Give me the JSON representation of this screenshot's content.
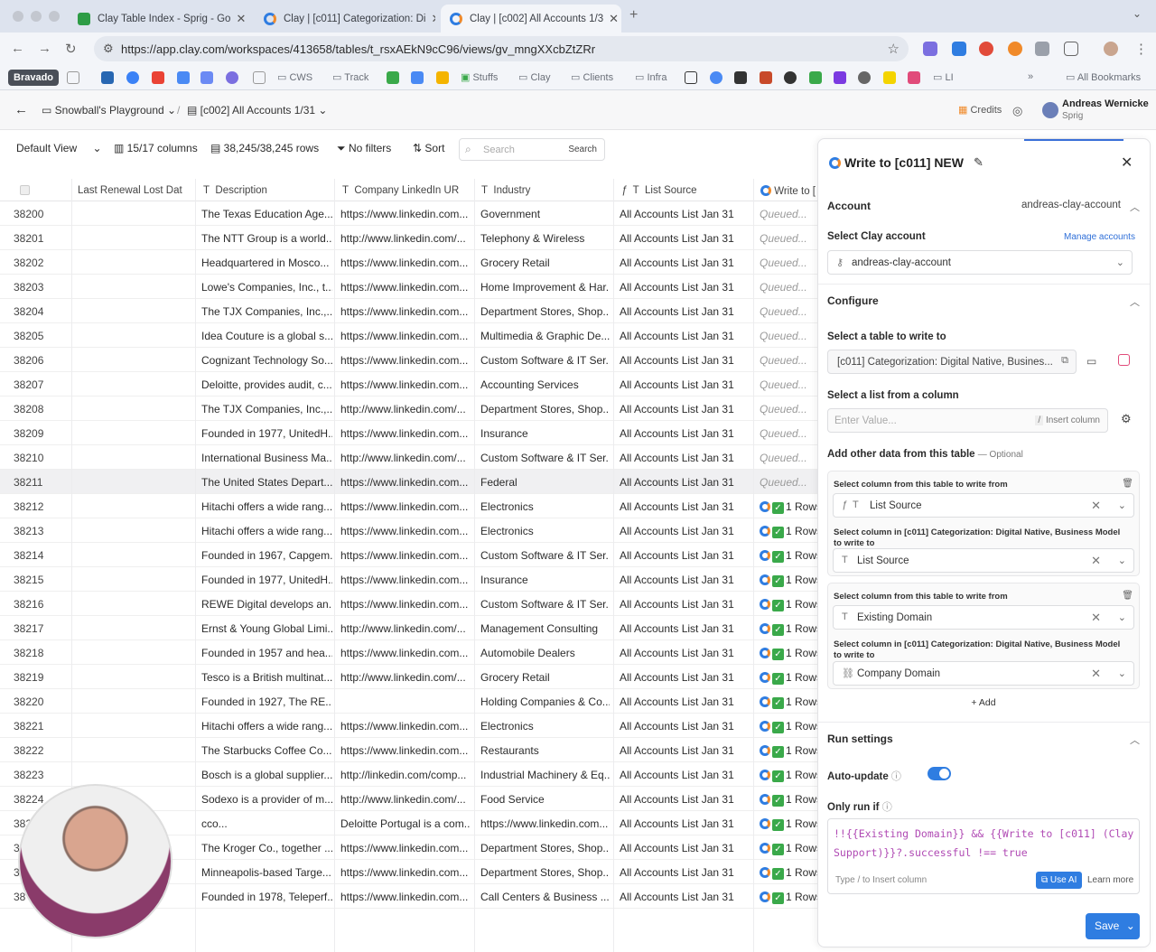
{
  "browser": {
    "tabs": [
      {
        "title": "Clay Table Index - Sprig - Go",
        "active": false
      },
      {
        "title": "Clay | [c011] Categorization: Di",
        "active": false
      },
      {
        "title": "Clay | [c002] All Accounts 1/3",
        "active": true
      }
    ],
    "url": "https://app.clay.com/workspaces/413658/tables/t_rsxAEkN9cC96/views/gv_mngXXcbZtZRr",
    "bookmarks": [
      "Bravado",
      "CWS",
      "Track",
      "Stuffs",
      "Clay",
      "Clients",
      "Infra",
      "LI",
      "All Bookmarks"
    ]
  },
  "header": {
    "workspace": "Snowball's Playground",
    "table": "[c002] All Accounts 1/31",
    "credits": "Credits",
    "user_name": "Andreas Wernicke",
    "user_org": "Sprig"
  },
  "toolbar": {
    "view": "Default View",
    "columns": "15/17 columns",
    "rows": "38,245/38,245 rows",
    "filters": "No filters",
    "sort": "Sort",
    "search_placeholder": "Search",
    "search_btn": "Search"
  },
  "grid": {
    "headers": [
      "Last Renewal Lost Dat",
      "Description",
      "Company LinkedIn UR",
      "Industry",
      "List Source",
      "Write to ["
    ],
    "rows": [
      {
        "num": "38200",
        "desc": "The Texas Education Age...",
        "li": "https://www.linkedin.com...",
        "ind": "Government",
        "ls": "All Accounts List Jan 31",
        "wr": "Queued..."
      },
      {
        "num": "38201",
        "desc": "The NTT Group is a world...",
        "li": "http://www.linkedin.com/...",
        "ind": "Telephony & Wireless",
        "ls": "All Accounts List Jan 31",
        "wr": "Queued..."
      },
      {
        "num": "38202",
        "desc": "Headquartered in Mosco...",
        "li": "https://www.linkedin.com...",
        "ind": "Grocery Retail",
        "ls": "All Accounts List Jan 31",
        "wr": "Queued..."
      },
      {
        "num": "38203",
        "desc": "Lowe's Companies, Inc., t...",
        "li": "https://www.linkedin.com...",
        "ind": "Home Improvement & Har...",
        "ls": "All Accounts List Jan 31",
        "wr": "Queued..."
      },
      {
        "num": "38204",
        "desc": "The TJX Companies, Inc.,...",
        "li": "https://www.linkedin.com...",
        "ind": "Department Stores, Shop...",
        "ls": "All Accounts List Jan 31",
        "wr": "Queued..."
      },
      {
        "num": "38205",
        "desc": "Idea Couture is a global s...",
        "li": "https://www.linkedin.com...",
        "ind": "Multimedia & Graphic De...",
        "ls": "All Accounts List Jan 31",
        "wr": "Queued..."
      },
      {
        "num": "38206",
        "desc": "Cognizant Technology So...",
        "li": "https://www.linkedin.com...",
        "ind": "Custom Software & IT Ser...",
        "ls": "All Accounts List Jan 31",
        "wr": "Queued..."
      },
      {
        "num": "38207",
        "desc": "Deloitte, provides audit, c...",
        "li": "https://www.linkedin.com...",
        "ind": "Accounting Services",
        "ls": "All Accounts List Jan 31",
        "wr": "Queued..."
      },
      {
        "num": "38208",
        "desc": "The TJX Companies, Inc.,...",
        "li": "http://www.linkedin.com/...",
        "ind": "Department Stores, Shop...",
        "ls": "All Accounts List Jan 31",
        "wr": "Queued..."
      },
      {
        "num": "38209",
        "desc": "Founded in 1977, UnitedH...",
        "li": "https://www.linkedin.com...",
        "ind": "Insurance",
        "ls": "All Accounts List Jan 31",
        "wr": "Queued..."
      },
      {
        "num": "38210",
        "desc": "International Business Ma...",
        "li": "http://www.linkedin.com/...",
        "ind": "Custom Software & IT Ser...",
        "ls": "All Accounts List Jan 31",
        "wr": "Queued..."
      },
      {
        "num": "38211",
        "desc": "The United States Depart...",
        "li": "https://www.linkedin.com...",
        "ind": "Federal",
        "ls": "All Accounts List Jan 31",
        "wr": "Queued...",
        "hl": true
      },
      {
        "num": "38212",
        "desc": "Hitachi offers a wide rang...",
        "li": "https://www.linkedin.com...",
        "ind": "Electronics",
        "ls": "All Accounts List Jan 31",
        "wr": "1 Rows"
      },
      {
        "num": "38213",
        "desc": "Hitachi offers a wide rang...",
        "li": "https://www.linkedin.com...",
        "ind": "Electronics",
        "ls": "All Accounts List Jan 31",
        "wr": "1 Rows"
      },
      {
        "num": "38214",
        "desc": "Founded in 1967, Capgem...",
        "li": "https://www.linkedin.com...",
        "ind": "Custom Software & IT Ser...",
        "ls": "All Accounts List Jan 31",
        "wr": "1 Rows"
      },
      {
        "num": "38215",
        "desc": "Founded in 1977, UnitedH...",
        "li": "https://www.linkedin.com...",
        "ind": "Insurance",
        "ls": "All Accounts List Jan 31",
        "wr": "1 Rows"
      },
      {
        "num": "38216",
        "desc": "REWE Digital develops an...",
        "li": "https://www.linkedin.com...",
        "ind": "Custom Software & IT Ser...",
        "ls": "All Accounts List Jan 31",
        "wr": "1 Rows"
      },
      {
        "num": "38217",
        "desc": "Ernst & Young Global Limi...",
        "li": "http://www.linkedin.com/...",
        "ind": "Management Consulting",
        "ls": "All Accounts List Jan 31",
        "wr": "1 Rows"
      },
      {
        "num": "38218",
        "desc": "Founded in 1957 and hea...",
        "li": "https://www.linkedin.com...",
        "ind": "Automobile Dealers",
        "ls": "All Accounts List Jan 31",
        "wr": "1 Rows"
      },
      {
        "num": "38219",
        "desc": "Tesco is a British multinat...",
        "li": "http://www.linkedin.com/...",
        "ind": "Grocery Retail",
        "ls": "All Accounts List Jan 31",
        "wr": "1 Rows"
      },
      {
        "num": "38220",
        "desc": "Founded in 1927, The RE...",
        "li": "",
        "ind": "Holding Companies & Co...",
        "ls": "All Accounts List Jan 31",
        "wr": "1 Rows"
      },
      {
        "num": "38221",
        "desc": "Hitachi offers a wide rang...",
        "li": "https://www.linkedin.com...",
        "ind": "Electronics",
        "ls": "All Accounts List Jan 31",
        "wr": "1 Rows"
      },
      {
        "num": "38222",
        "desc": "The Starbucks Coffee Co...",
        "li": "https://www.linkedin.com...",
        "ind": "Restaurants",
        "ls": "All Accounts List Jan 31",
        "wr": "1 Rows"
      },
      {
        "num": "38223",
        "desc": "Bosch is a global supplier...",
        "li": "http://linkedin.com/comp...",
        "ind": "Industrial Machinery & Eq...",
        "ls": "All Accounts List Jan 31",
        "wr": "1 Rows"
      },
      {
        "num": "38224",
        "desc": "Sodexo is a provider of m...",
        "li": "http://www.linkedin.com/...",
        "ind": "Food Service",
        "ls": "All Accounts List Jan 31",
        "wr": "1 Rows"
      },
      {
        "num": "382",
        "desc": "cco...",
        "li": "Deloitte Portugal is a com...",
        "ind": "https://www.linkedin.com...",
        "ls": "All Accounts List Jan 31",
        "wr": "1 Rows"
      },
      {
        "num": "3",
        "desc": "The Kroger Co., together ...",
        "li": "https://www.linkedin.com...",
        "ind": "Department Stores, Shop...",
        "ls": "All Accounts List Jan 31",
        "wr": "1 Rows"
      },
      {
        "num": "3",
        "desc": "Minneapolis-based Targe...",
        "li": "https://www.linkedin.com...",
        "ind": "Department Stores, Shop...",
        "ls": "All Accounts List Jan 31",
        "wr": "1 Rows"
      },
      {
        "num": "38",
        "desc": "Founded in 1978, Teleperf...",
        "li": "https://www.linkedin.com...",
        "ind": "Call Centers & Business ...",
        "ls": "All Accounts List Jan 31",
        "wr": "1 Rows"
      }
    ]
  },
  "panel": {
    "title": "Write to [c011] NEW",
    "account_section": "Account",
    "account_value": "andreas-clay-account",
    "select_account_label": "Select Clay account",
    "manage_accounts": "Manage accounts",
    "account_selected": "andreas-clay-account",
    "configure_section": "Configure",
    "table_label": "Select a table to write to",
    "table_value": "[c011] Categorization: Digital Native, Busines...",
    "list_label": "Select a list from a column",
    "list_placeholder": "Enter Value...",
    "insert_column": "Insert column",
    "add_other_label": "Add other data from this table",
    "optional": "— Optional",
    "map1_from_label": "Select column from this table to write from",
    "map1_from_value": "List Source",
    "map1_to_label": "Select column in [c011] Categorization: Digital Native, Business Model to write to",
    "map1_to_value": "List Source",
    "map2_from_label": "Select column from this table to write from",
    "map2_from_value": "Existing Domain",
    "map2_to_label": "Select column in [c011] Categorization: Digital Native, Business Model to write to",
    "map2_to_value": "Company Domain",
    "add": "+ Add",
    "run_section": "Run settings",
    "auto_update": "Auto-update",
    "only_run_if": "Only run if",
    "formula_line1": "!!{{Existing Domain}} && {{Write to [c011] (Clay",
    "formula_line2": "Support)}}?.successful !== true",
    "type_hint": "Type / to Insert column",
    "use_ai": "Use AI",
    "learn_more": "Learn more",
    "save": "Save"
  }
}
